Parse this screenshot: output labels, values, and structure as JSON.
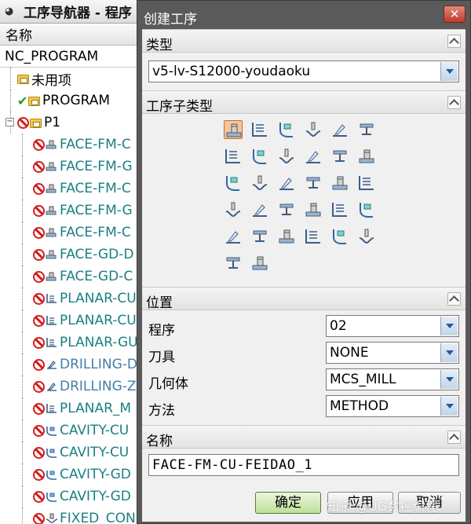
{
  "navigator": {
    "title": "工序导航器 - 程序",
    "column_header": "名称",
    "root": "NC_PROGRAM",
    "items": [
      {
        "label": "未用项",
        "status": "none",
        "kind": "folder",
        "depth": 1
      },
      {
        "label": "PROGRAM",
        "status": "check",
        "kind": "folder",
        "depth": 1
      },
      {
        "label": "P1",
        "status": "forbid",
        "kind": "folder",
        "depth": 1
      },
      {
        "label": "FACE-FM-C",
        "status": "forbid",
        "kind": "face",
        "depth": 2
      },
      {
        "label": "FACE-FM-G",
        "status": "forbid",
        "kind": "face",
        "depth": 2
      },
      {
        "label": "FACE-FM-C",
        "status": "forbid",
        "kind": "face",
        "depth": 2
      },
      {
        "label": "FACE-FM-G",
        "status": "forbid",
        "kind": "face",
        "depth": 2
      },
      {
        "label": "FACE-FM-C",
        "status": "forbid",
        "kind": "face",
        "depth": 2
      },
      {
        "label": "FACE-GD-D",
        "status": "forbid",
        "kind": "face",
        "depth": 2
      },
      {
        "label": "FACE-GD-C",
        "status": "forbid",
        "kind": "face",
        "depth": 2
      },
      {
        "label": "PLANAR-CU",
        "status": "forbid",
        "kind": "planar",
        "depth": 2
      },
      {
        "label": "PLANAR-CU",
        "status": "forbid",
        "kind": "planar",
        "depth": 2
      },
      {
        "label": "PLANAR-GU",
        "status": "forbid",
        "kind": "planar",
        "depth": 2
      },
      {
        "label": "DRILLING-D",
        "status": "forbid",
        "kind": "drill",
        "depth": 2
      },
      {
        "label": "DRILLING-Z",
        "status": "forbid",
        "kind": "drill",
        "depth": 2
      },
      {
        "label": "PLANAR_M",
        "status": "forbid",
        "kind": "planar",
        "depth": 2
      },
      {
        "label": "CAVITY-CU",
        "status": "forbid",
        "kind": "cavity",
        "depth": 2
      },
      {
        "label": "CAVITY-CU",
        "status": "forbid",
        "kind": "cavity",
        "depth": 2
      },
      {
        "label": "CAVITY-GD",
        "status": "forbid",
        "kind": "cavity",
        "depth": 2
      },
      {
        "label": "CAVITY-GD",
        "status": "forbid",
        "kind": "cavity",
        "depth": 2
      },
      {
        "label": "FIXED_CON",
        "status": "forbid",
        "kind": "fixed",
        "depth": 2
      }
    ]
  },
  "dialog": {
    "title": "创建工序",
    "close_glyph": "✕",
    "type_section": {
      "label": "类型",
      "value": "v5-lv-S12000-youdaoku"
    },
    "subtype_section": {
      "label": "工序子类型",
      "icon_rows": [
        6,
        6,
        6,
        6,
        6,
        2
      ],
      "selected_index": 0
    },
    "location_section": {
      "label": "位置",
      "fields": [
        {
          "label": "程序",
          "value": "02"
        },
        {
          "label": "刀具",
          "value": "NONE"
        },
        {
          "label": "几何体",
          "value": "MCS_MILL"
        },
        {
          "label": "方法",
          "value": "METHOD"
        }
      ]
    },
    "name_section": {
      "label": "名称",
      "value": "FACE-FM-CU-FEIDAO_1"
    },
    "buttons": {
      "ok": "确定",
      "apply": "应用",
      "cancel": "取消"
    },
    "watermark": "知乎 @UG数控编程"
  },
  "colors": {
    "teal_text": "#1a7f82",
    "blue_text": "#3f7fa8",
    "dialog_frame": "#5a5a5a",
    "dialog_body": "#f0f0f0",
    "ok_button": "#bfe09a",
    "close_button": "#c0392b"
  },
  "icons": {
    "forbid": "forbidden-circle-icon",
    "check": "green-check-icon",
    "folder": "program-folder-icon",
    "collapse": "collapse-chevron-icon",
    "dropdown": "dropdown-arrow-icon"
  }
}
